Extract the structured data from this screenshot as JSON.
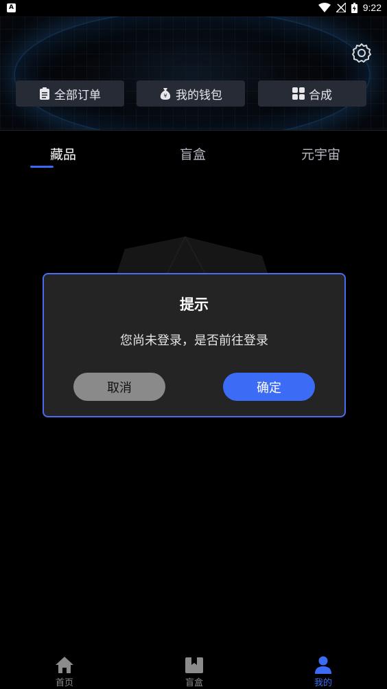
{
  "status_bar": {
    "time": "9:22"
  },
  "header": {
    "quick_actions": [
      {
        "label": "全部订单",
        "icon": "clipboard-icon"
      },
      {
        "label": "我的钱包",
        "icon": "money-bag-icon"
      },
      {
        "label": "合成",
        "icon": "grid-icon"
      }
    ],
    "settings_icon": "gear-icon"
  },
  "tabs": [
    {
      "label": "藏品",
      "active": true
    },
    {
      "label": "盲盒",
      "active": false
    },
    {
      "label": "元宇宙",
      "active": false
    }
  ],
  "dialog": {
    "title": "提示",
    "message": "您尚未登录，是否前往登录",
    "cancel_label": "取消",
    "confirm_label": "确定"
  },
  "bottom_nav": [
    {
      "label": "首页",
      "icon": "home-icon",
      "active": false
    },
    {
      "label": "盲盒",
      "icon": "box-icon",
      "active": false
    },
    {
      "label": "我的",
      "icon": "user-icon",
      "active": true
    }
  ],
  "colors": {
    "accent": "#3c6cf6",
    "dialog_border": "#4a6cf0",
    "dialog_bg": "#242424",
    "button_bg": "#262b35"
  }
}
